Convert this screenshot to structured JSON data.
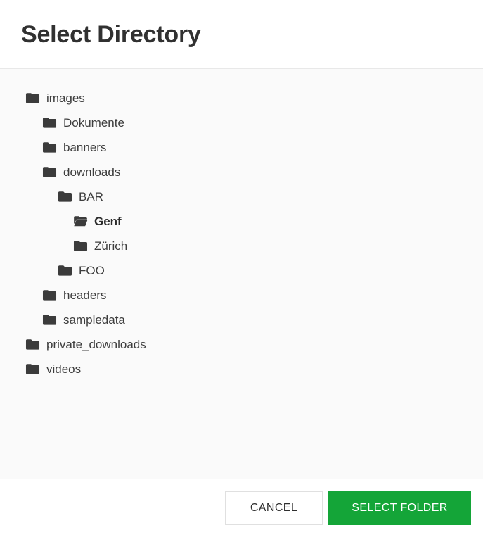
{
  "dialog": {
    "title": "Select Directory"
  },
  "tree": {
    "items": [
      {
        "label": "images",
        "depth": 0,
        "icon": "folder-icon",
        "selected": false
      },
      {
        "label": "Dokumente",
        "depth": 1,
        "icon": "folder-icon",
        "selected": false
      },
      {
        "label": "banners",
        "depth": 1,
        "icon": "folder-icon",
        "selected": false
      },
      {
        "label": "downloads",
        "depth": 1,
        "icon": "folder-icon",
        "selected": false
      },
      {
        "label": "BAR",
        "depth": 2,
        "icon": "folder-icon",
        "selected": false
      },
      {
        "label": "Genf",
        "depth": 3,
        "icon": "folder-open-icon",
        "selected": true
      },
      {
        "label": "Zürich",
        "depth": 3,
        "icon": "folder-icon",
        "selected": false
      },
      {
        "label": "FOO",
        "depth": 2,
        "icon": "folder-icon",
        "selected": false
      },
      {
        "label": "headers",
        "depth": 1,
        "icon": "folder-icon",
        "selected": false
      },
      {
        "label": "sampledata",
        "depth": 1,
        "icon": "folder-icon",
        "selected": false
      },
      {
        "label": "private_downloads",
        "depth": 0,
        "icon": "folder-icon",
        "selected": false
      },
      {
        "label": "videos",
        "depth": 0,
        "icon": "folder-icon",
        "selected": false
      }
    ]
  },
  "footer": {
    "cancel_label": "CANCEL",
    "select_label": "SELECT FOLDER"
  },
  "colors": {
    "primary": "#14a538",
    "primary_text": "#ffffff",
    "title_text": "#313131",
    "item_text": "#3d3d3d",
    "icon": "#3b3b3b",
    "body_background": "#fafafa",
    "header_background": "#ffffff",
    "divider": "#e8e8e8",
    "cancel_border": "#e0e0e0"
  }
}
